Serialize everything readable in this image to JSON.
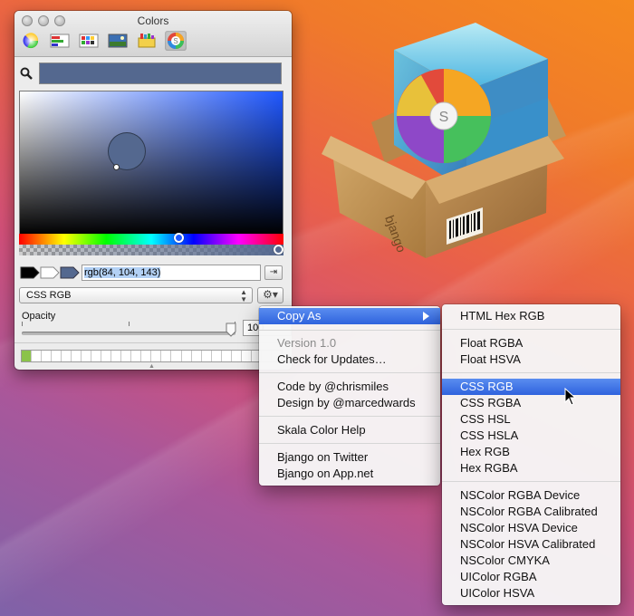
{
  "panel": {
    "title": "Colors",
    "tools": [
      "color-wheel-icon",
      "color-sliders-icon",
      "color-palettes-icon",
      "image-palettes-icon",
      "crayons-icon",
      "skala-icon"
    ],
    "current_color_hex": "#54688f",
    "rgb_value": "rgb(84, 104, 143)",
    "format_select": "CSS RGB",
    "opacity_label": "Opacity",
    "opacity_value": "100",
    "opacity_percent": 100
  },
  "menu": {
    "items": [
      {
        "label": "Copy As",
        "state": "highlighted"
      },
      {
        "label": "Version 1.0",
        "state": "disabled"
      },
      {
        "label": "Check for Updates…"
      },
      {
        "label": "Code by @chrismiles"
      },
      {
        "label": "Design by @marcedwards"
      },
      {
        "label": "Skala Color Help"
      },
      {
        "label": "Bjango on Twitter"
      },
      {
        "label": "Bjango on App.net"
      }
    ]
  },
  "submenu": {
    "items": [
      {
        "label": "HTML Hex RGB"
      },
      {
        "label": "Float RGBA"
      },
      {
        "label": "Float HSVA"
      },
      {
        "label": "CSS RGB",
        "state": "highlighted"
      },
      {
        "label": "CSS RGBA"
      },
      {
        "label": "CSS HSL"
      },
      {
        "label": "CSS HSLA"
      },
      {
        "label": "Hex RGB"
      },
      {
        "label": "Hex RGBA"
      },
      {
        "label": "NSColor RGBA Device"
      },
      {
        "label": "NSColor RGBA Calibrated"
      },
      {
        "label": "NSColor HSVA Device"
      },
      {
        "label": "NSColor HSVA Calibrated"
      },
      {
        "label": "NSColor CMYKA"
      },
      {
        "label": "UIColor RGBA"
      },
      {
        "label": "UIColor HSVA"
      }
    ]
  },
  "app_icon": {
    "brand": "bjango"
  }
}
